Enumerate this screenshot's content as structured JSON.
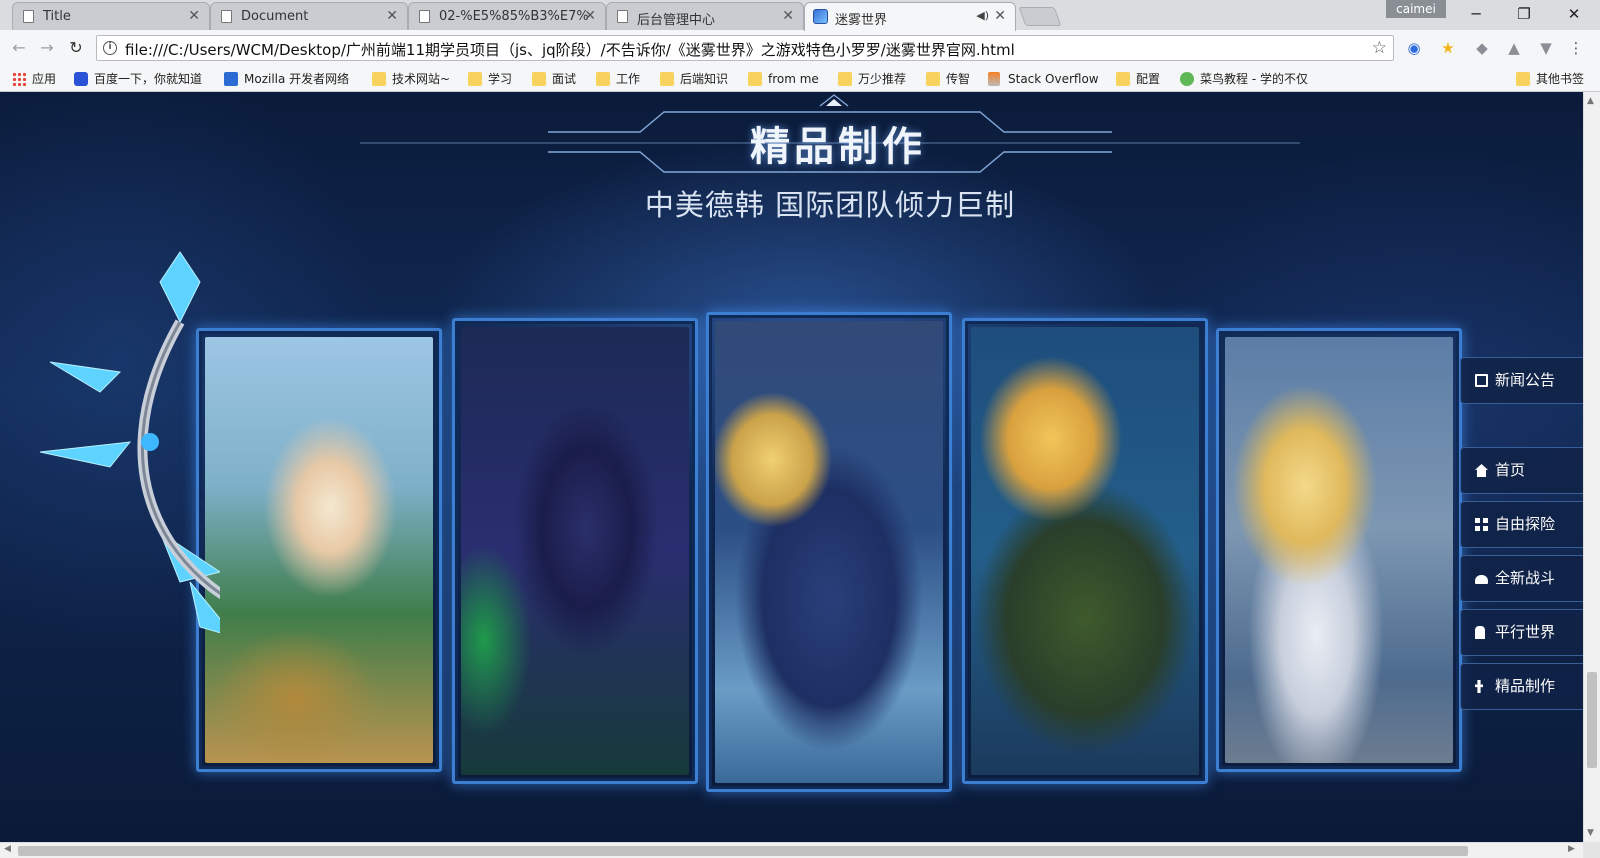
{
  "browser": {
    "tabs": [
      {
        "title": "Title",
        "active": false
      },
      {
        "title": "Document",
        "active": false
      },
      {
        "title": "02-%E5%85%B3%E7%",
        "active": false
      },
      {
        "title": "后台管理中心",
        "active": false
      },
      {
        "title": "迷雾世界",
        "active": true
      }
    ],
    "user": "caimei",
    "url": "file:///C:/Users/WCM/Desktop/广州前端11期学员项目（js、jq阶段）/不告诉你/《迷雾世界》之游戏特色小罗罗/迷雾世界官网.html",
    "bookmarks": [
      {
        "label": "应用",
        "icon": "apps-icon"
      },
      {
        "label": "百度一下，你就知道",
        "icon": "baidu-icon"
      },
      {
        "label": "Mozilla 开发者网络",
        "icon": "mozilla-icon"
      },
      {
        "label": "技术网站~",
        "icon": "folder-icon"
      },
      {
        "label": "学习",
        "icon": "folder-icon"
      },
      {
        "label": "面试",
        "icon": "folder-icon"
      },
      {
        "label": "工作",
        "icon": "folder-icon"
      },
      {
        "label": "后端知识",
        "icon": "folder-icon"
      },
      {
        "label": "from me",
        "icon": "folder-icon"
      },
      {
        "label": "万少推荐",
        "icon": "folder-icon"
      },
      {
        "label": "传智",
        "icon": "folder-icon"
      },
      {
        "label": "Stack Overflow",
        "icon": "stackoverflow-icon"
      },
      {
        "label": "配置",
        "icon": "folder-icon"
      },
      {
        "label": "菜鸟教程 - 学的不仅",
        "icon": "runoob-icon"
      }
    ],
    "other_bookmarks": "其他书签"
  },
  "page": {
    "section_title": "精品制作",
    "subtitle": "中美德韩 国际团队倾力巨制",
    "cards": [
      {
        "name": "elf-archer"
      },
      {
        "name": "hooded-shadow"
      },
      {
        "name": "ice-princess"
      },
      {
        "name": "golden-warrior"
      },
      {
        "name": "light-fairy"
      }
    ],
    "sidenav": [
      {
        "label": "新闻公告",
        "icon": "news-icon"
      },
      {
        "label": "首页",
        "icon": "home-icon"
      },
      {
        "label": "自由探险",
        "icon": "grid-icon"
      },
      {
        "label": "全新战斗",
        "icon": "battle-icon"
      },
      {
        "label": "平行世界",
        "icon": "world-icon"
      },
      {
        "label": "精品制作",
        "icon": "craft-icon"
      }
    ]
  },
  "colors": {
    "accent": "#3c7fd2",
    "bg_dark": "#0b1b3a",
    "folder": "#f7d25c"
  }
}
